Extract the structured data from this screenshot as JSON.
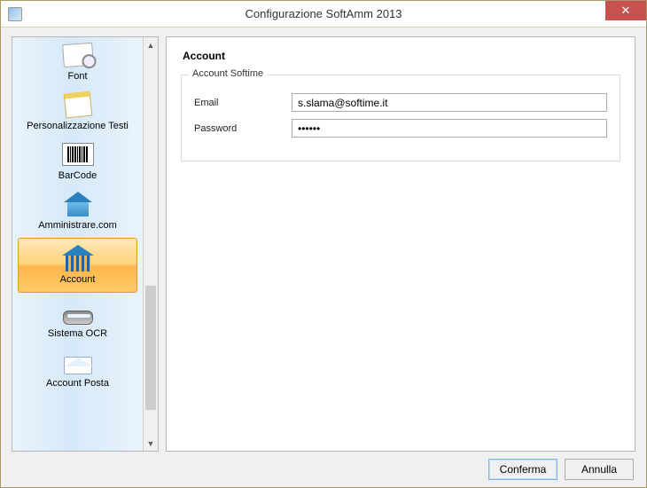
{
  "window": {
    "title": "Configurazione SoftAmm 2013"
  },
  "sidebar": {
    "items": [
      {
        "label": "Font"
      },
      {
        "label": "Personalizzazione Testi"
      },
      {
        "label": "BarCode"
      },
      {
        "label": "Amministrare.com"
      },
      {
        "label": "Account"
      },
      {
        "label": "Sistema OCR"
      },
      {
        "label": "Account Posta"
      }
    ],
    "selected_index": 4
  },
  "panel": {
    "heading": "Account",
    "fieldset_legend": "Account Softime",
    "email_label": "Email",
    "email_value": "s.slama@softime.it",
    "password_label": "Password",
    "password_value": "••••••"
  },
  "footer": {
    "confirm_label": "Conferma",
    "cancel_label": "Annulla"
  }
}
